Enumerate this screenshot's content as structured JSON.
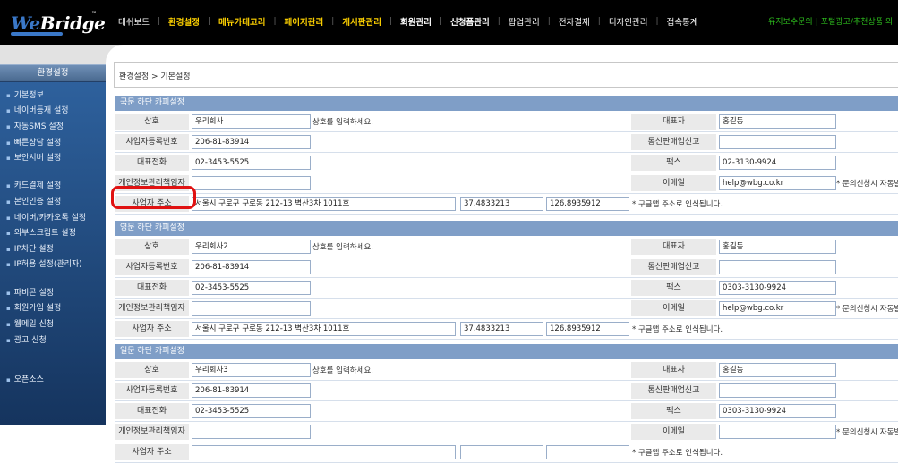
{
  "logo": {
    "w": "We",
    "bridge": "Bridge",
    "tm": "™"
  },
  "topnav": [
    {
      "label": "대쉬보드",
      "style": "normal"
    },
    {
      "label": "환경설정",
      "style": "hl"
    },
    {
      "label": "메뉴카테고리",
      "style": "hl"
    },
    {
      "label": "페이지관리",
      "style": "hl"
    },
    {
      "label": "게시판관리",
      "style": "hl"
    },
    {
      "label": "회원관리",
      "style": "bold"
    },
    {
      "label": "신청폼관리",
      "style": "bold"
    },
    {
      "label": "팝업관리",
      "style": "normal"
    },
    {
      "label": "전자결제",
      "style": "normal"
    },
    {
      "label": "디자인관리",
      "style": "normal"
    },
    {
      "label": "접속통계",
      "style": "normal"
    }
  ],
  "topright": {
    "maintenance": "유지보수문의",
    "separator": "|",
    "ads": "포털광고/추천상품 외"
  },
  "sidebar": {
    "title": "환경설정",
    "items": [
      "기본정보",
      "네이버등재 설정",
      "자동SMS 설정",
      "빠른상담 설정",
      "보안서버 설정",
      "카드결제 설정",
      "본인인증 설정",
      "네이버/카카오톡 설정",
      "외부스크립트 설정",
      "IP차단 설정",
      "IP허용 설정(관리자)",
      "파비콘 설정",
      "회원가입 설정",
      "웹메일 신청",
      "광고 신청",
      "오픈소스"
    ]
  },
  "breadcrumb": "환경설정 > 기본설정",
  "labels": {
    "company": "상호",
    "ceo": "대표자",
    "bizno": "사업자등록번호",
    "mailorder": "통신판매업신고",
    "phone": "대표전화",
    "fax": "팩스",
    "privacy": "개인정보관리책임자",
    "email": "이메일",
    "address": "사업자 주소",
    "company_hint": "상호를 입력하세요.",
    "email_hint": "* 문의신청시 자동발송",
    "address_hint": "* 구글맵 주소로 인식됩니다."
  },
  "sections": [
    {
      "title": "국문 하단 카피설정",
      "company": "우리회사",
      "ceo": "홍길동",
      "bizno": "206-81-83914",
      "mailorder": "",
      "phone": "02-3453-5525",
      "fax": "02-3130-9924",
      "privacy": "",
      "email": "help@wbg.co.kr",
      "address": "서울시 구로구 구로동 212-13 벽산3차 1011호",
      "lat": "37.4833213",
      "lng": "126.8935912"
    },
    {
      "title": "영문 하단 카피설정",
      "company": "우리회사2",
      "ceo": "홍길동",
      "bizno": "206-81-83914",
      "mailorder": "",
      "phone": "02-3453-5525",
      "fax": "0303-3130-9924",
      "privacy": "",
      "email": "help@wbg.co.kr",
      "address": "서울시 구로구 구로동 212-13 벽산3차 1011호",
      "lat": "37.4833213",
      "lng": "126.8935912"
    },
    {
      "title": "일문 하단 카피설정",
      "company": "우리회사3",
      "ceo": "홍길동",
      "bizno": "206-81-83914",
      "mailorder": "",
      "phone": "02-3453-5525",
      "fax": "0303-3130-9924",
      "privacy": "",
      "email": "",
      "address": "",
      "lat": "",
      "lng": ""
    }
  ],
  "colors": {
    "header_bg": "#000000",
    "nav_highlight": "#ffd200",
    "green_link": "#2dbb1d",
    "section_bar": "#7f9ec7",
    "sidebar_top": "#2f63a0",
    "highlight_ring": "#e01212"
  }
}
